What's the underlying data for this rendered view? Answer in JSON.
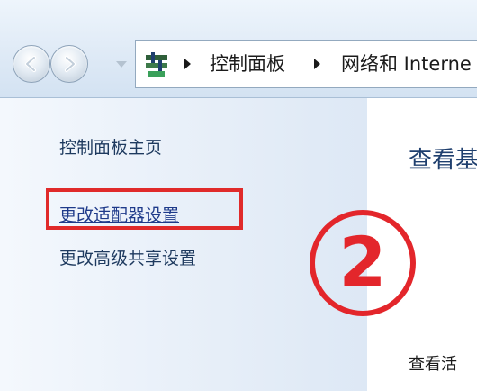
{
  "address_bar": {
    "icon": "control-panel-icon",
    "crumbs": [
      "控制面板",
      "网络和 Interne"
    ]
  },
  "left_nav": {
    "items": [
      {
        "label": "控制面板主页"
      },
      {
        "label": "更改适配器设置"
      },
      {
        "label": "更改高级共享设置"
      }
    ]
  },
  "annotation": {
    "step_marker": "2",
    "color": "#e3262b"
  },
  "main": {
    "title": "查看基",
    "section_label": "查看活"
  }
}
